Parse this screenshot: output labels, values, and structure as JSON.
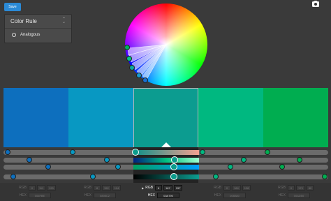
{
  "toolbar": {
    "save_label": "Save",
    "camera_icon": "camera-icon"
  },
  "color_rule": {
    "title": "Color Rule",
    "selected_option": "Analogous",
    "chevron_icon": "chevron-icon"
  },
  "swatches": [
    "#0d6fbe",
    "#0898c2",
    "#0c9c90",
    "#00b880",
    "#00ad50"
  ],
  "selected_index": 2,
  "selected_values": {
    "rgb_label": "RGB",
    "hex_label": "HEX",
    "r": "8",
    "g": "167",
    "b": "157",
    "hex": "00A790"
  },
  "other_values": [
    {
      "rgb_label": "RGB",
      "hex_label": "HEX",
      "r": "0",
      "g": "111",
      "b": "190",
      "hex": "006FBE"
    },
    {
      "rgb_label": "RGB",
      "hex_label": "HEX",
      "r": "8",
      "g": "152",
      "b": "194",
      "hex": "0898C2"
    },
    {
      "rgb_label": "RGB",
      "hex_label": "HEX",
      "r": "0",
      "g": "184",
      "b": "128",
      "hex": "00B880"
    },
    {
      "rgb_label": "RGB",
      "hex_label": "HEX",
      "r": "0",
      "g": "173",
      "b": "80",
      "hex": "00AD50"
    }
  ]
}
